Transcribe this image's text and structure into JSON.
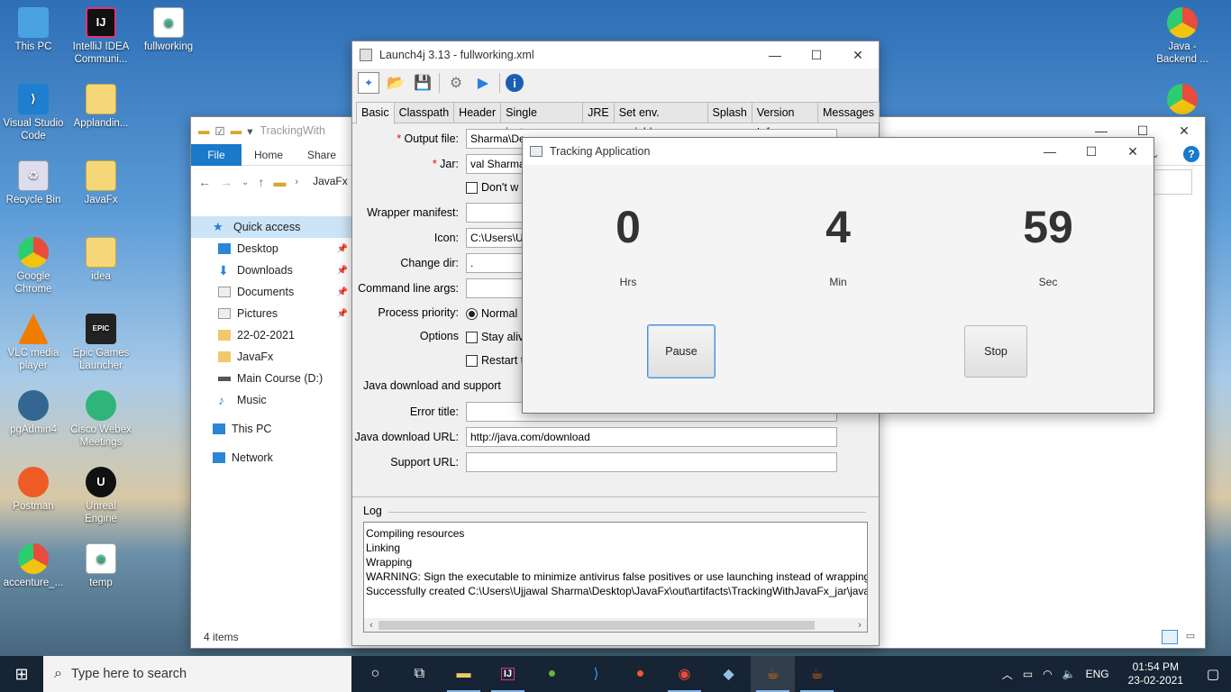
{
  "desktop": {
    "icons": [
      {
        "label": "This PC",
        "icon": "pc"
      },
      {
        "label": "IntelliJ IDEA Communi...",
        "icon": "ij"
      },
      {
        "label": "fullworking",
        "icon": "doc"
      },
      {
        "label": "Visual Studio Code",
        "icon": "vs"
      },
      {
        "label": "Applandin...",
        "icon": "fold"
      },
      {
        "label": "Recycle Bin",
        "icon": "bin"
      },
      {
        "label": "JavaFx",
        "icon": "fold"
      },
      {
        "label": "Google Chrome",
        "icon": "chrome"
      },
      {
        "label": "idea",
        "icon": "fold"
      },
      {
        "label": "VLC media player",
        "icon": "vlc"
      },
      {
        "label": "Epic Games Launcher",
        "icon": "epic"
      },
      {
        "label": "pgAdmin4",
        "icon": "pg"
      },
      {
        "label": "Cisco Webex Meetings",
        "icon": "webex"
      },
      {
        "label": "Postman",
        "icon": "post"
      },
      {
        "label": "Unreal Engine",
        "icon": "ue"
      },
      {
        "label": "accenture_...",
        "icon": "chrome"
      },
      {
        "label": "temp",
        "icon": "doc"
      },
      {
        "label": "Java - Backend ...",
        "icon": "chrome"
      }
    ]
  },
  "explorer": {
    "title": "TrackingWith",
    "ribbon_tabs": [
      "File",
      "Home",
      "Share"
    ],
    "address": "JavaFx",
    "nav": [
      {
        "label": "Quick access",
        "icon": "star"
      },
      {
        "label": "Desktop",
        "icon": "blue"
      },
      {
        "label": "Downloads",
        "icon": "blue"
      },
      {
        "label": "Documents",
        "icon": "doc"
      },
      {
        "label": "Pictures",
        "icon": "doc"
      },
      {
        "label": "22-02-2021",
        "icon": "fold"
      },
      {
        "label": "JavaFx",
        "icon": "fold"
      },
      {
        "label": "Main Course (D:)",
        "icon": "drive"
      },
      {
        "label": "Music",
        "icon": "blue"
      },
      {
        "label": "This PC",
        "icon": "blue"
      },
      {
        "label": "Network",
        "icon": "blue"
      }
    ],
    "status": "4 items"
  },
  "launch4j": {
    "title": "Launch4j 3.13 - fullworking.xml",
    "tabs": [
      "Basic",
      "Classpath",
      "Header",
      "Single instance",
      "JRE",
      "Set env. variables",
      "Splash",
      "Version Info",
      "Messages"
    ],
    "fields": {
      "output_file_label": "Output file:",
      "output_file_value": "Sharma\\De",
      "jar_label": "Jar:",
      "jar_value": "val Sharma\\",
      "dont_wrap_label": "Don't w",
      "wrapper_manifest_label": "Wrapper manifest:",
      "icon_label": "Icon:",
      "icon_value": "C:\\Users\\Uj",
      "change_dir_label": "Change dir:",
      "change_dir_value": ".",
      "cmd_args_label": "Command line args:",
      "priority_label": "Process priority:",
      "priority_value": "Normal",
      "options_label": "Options",
      "stay_alive_label": "Stay alive",
      "restart_label": "Restart th",
      "java_download_section": "Java download and support",
      "error_title_label": "Error title:",
      "java_download_url_label": "Java download URL:",
      "java_download_url_value": "http://java.com/download",
      "support_url_label": "Support URL:"
    },
    "log_label": "Log",
    "log_lines": [
      "Compiling resources",
      "Linking",
      "Wrapping",
      "WARNING: Sign the executable to minimize antivirus false positives or use launching instead of wrapping.",
      "Successfully created C:\\Users\\Ujjawal Sharma\\Desktop\\JavaFx\\out\\artifacts\\TrackingWithJavaFx_jar\\javafx"
    ]
  },
  "tracker": {
    "title": "Tracking Application",
    "hours": "0",
    "minutes": "4",
    "seconds": "59",
    "hours_label": "Hrs",
    "minutes_label": "Min",
    "seconds_label": "Sec",
    "pause_label": "Pause",
    "stop_label": "Stop"
  },
  "taskbar": {
    "search_placeholder": "Type here to search",
    "language": "ENG",
    "time": "01:54 PM",
    "date": "23-02-2021"
  }
}
